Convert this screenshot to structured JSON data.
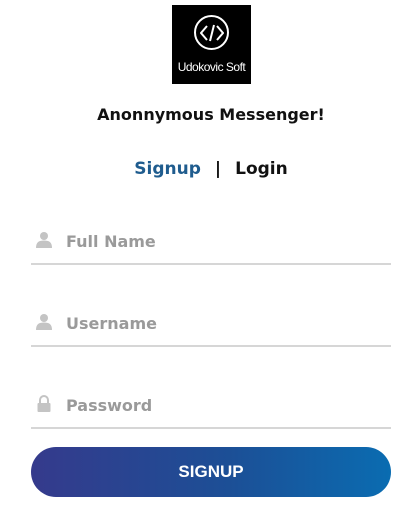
{
  "logo": {
    "text": "Udokovic Soft",
    "icon": "code-brackets-icon"
  },
  "title": "Anonnymous Messenger!",
  "tabs": {
    "signup": "Signup",
    "separator": "|",
    "login": "Login",
    "active": "signup"
  },
  "form": {
    "full_name": {
      "placeholder": "Full Name",
      "value": "",
      "icon": "user-icon"
    },
    "username": {
      "placeholder": "Username",
      "value": "",
      "icon": "user-icon"
    },
    "password": {
      "placeholder": "Password",
      "value": "",
      "icon": "lock-icon"
    }
  },
  "submit_label": "SIGNUP",
  "colors": {
    "active_tab": "#1f5c8e",
    "button_gradient_start": "#353a8c",
    "button_gradient_end": "#0a6cb1",
    "field_underline": "#d6d6d6",
    "placeholder": "#9a9a9a"
  }
}
